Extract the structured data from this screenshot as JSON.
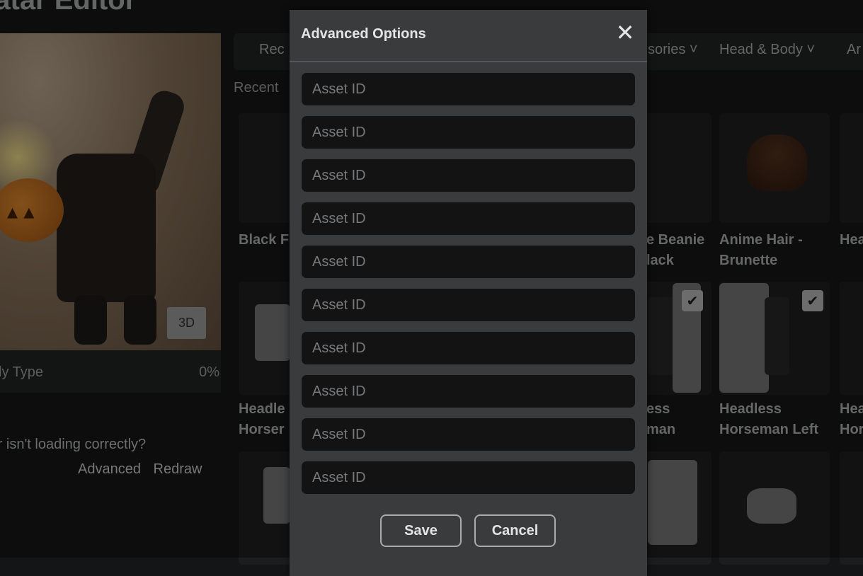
{
  "page": {
    "title": "vatar Editor"
  },
  "preview": {
    "button_3d": "3D",
    "body_type_label": "ly Type",
    "body_type_value": "0%"
  },
  "help": {
    "message": "tar isn't loading correctly?",
    "advanced_link": "Advanced",
    "redraw_link": "Redraw"
  },
  "tabs": [
    {
      "label": "Rec"
    },
    {
      "label": "sories ˅"
    },
    {
      "label": "Head & Body ˅"
    },
    {
      "label": "Ar"
    }
  ],
  "recent_label": "Recent",
  "items": [
    {
      "line1": "Black F",
      "line2": ""
    },
    {
      "line1": "e Beanie",
      "line2": "lack"
    },
    {
      "line1": "Anime Hair -",
      "line2": "Brunette"
    },
    {
      "line1": "Hea",
      "line2": ""
    },
    {
      "line1": "Headle",
      "line2": "Horser"
    },
    {
      "line1": "ess",
      "line2": "man"
    },
    {
      "line1": "Headless",
      "line2": "Horseman Left"
    },
    {
      "line1": "Hea",
      "line2": "Hor"
    }
  ],
  "modal": {
    "title": "Advanced Options",
    "close_icon": "close-icon",
    "asset_fields": [
      {
        "placeholder": "Asset ID",
        "value": ""
      },
      {
        "placeholder": "Asset ID",
        "value": ""
      },
      {
        "placeholder": "Asset ID",
        "value": ""
      },
      {
        "placeholder": "Asset ID",
        "value": ""
      },
      {
        "placeholder": "Asset ID",
        "value": ""
      },
      {
        "placeholder": "Asset ID",
        "value": ""
      },
      {
        "placeholder": "Asset ID",
        "value": ""
      },
      {
        "placeholder": "Asset ID",
        "value": ""
      },
      {
        "placeholder": "Asset ID",
        "value": ""
      },
      {
        "placeholder": "Asset ID",
        "value": ""
      }
    ],
    "save_label": "Save",
    "cancel_label": "Cancel"
  },
  "colors": {
    "modal_bg": "#393b3d",
    "input_bg": "#131314",
    "page_bg": "#141516"
  }
}
